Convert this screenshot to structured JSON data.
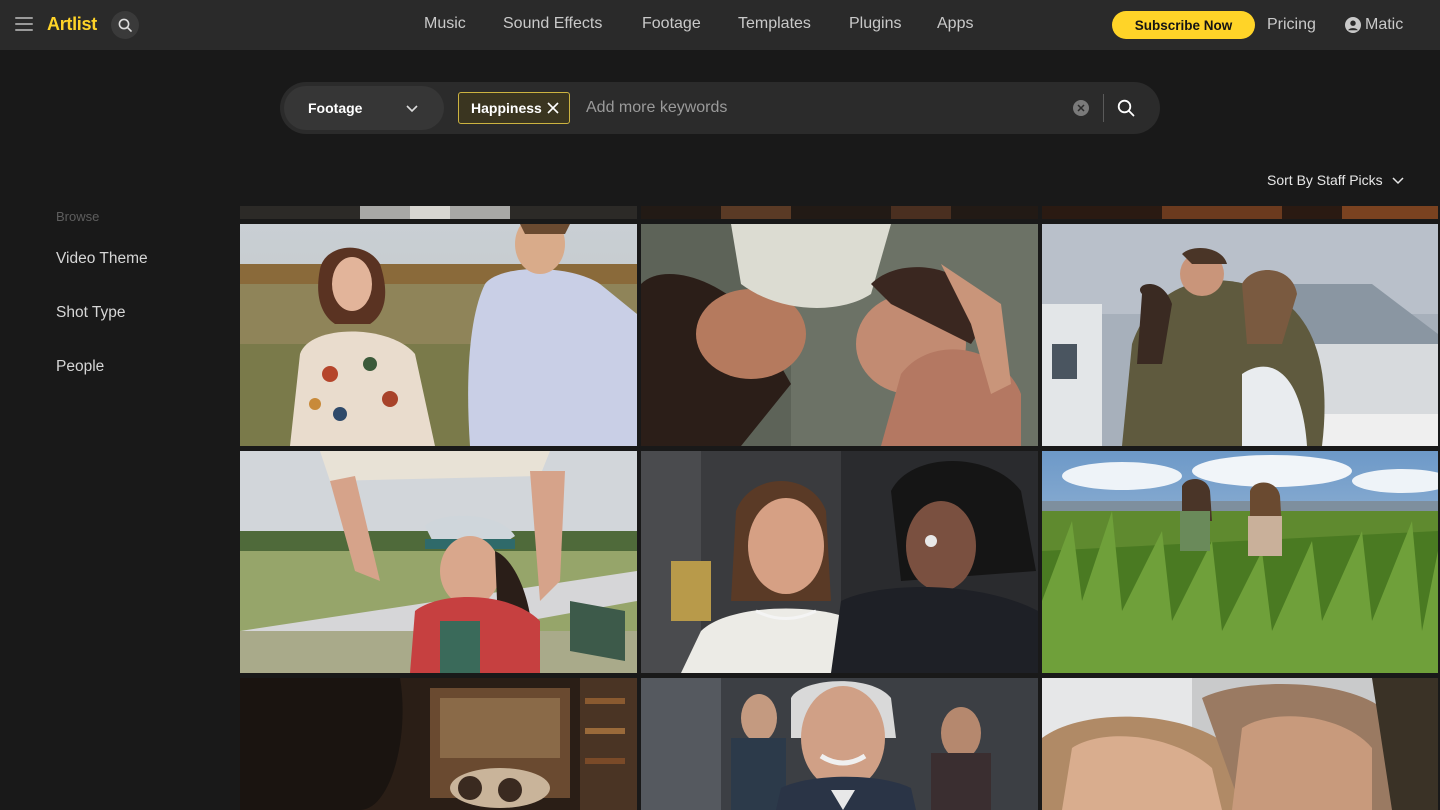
{
  "header": {
    "logo": "Artlist",
    "nav": [
      "Music",
      "Sound Effects",
      "Footage",
      "Templates",
      "Plugins",
      "Apps"
    ],
    "subscribe_label": "Subscribe Now",
    "pricing_label": "Pricing",
    "user_name": "Matic"
  },
  "search": {
    "type_label": "Footage",
    "chip_label": "Happiness",
    "placeholder": "Add more keywords"
  },
  "sort": {
    "label": "Sort By Staff Picks"
  },
  "sidebar": {
    "heading": "Browse",
    "items": [
      "Video Theme",
      "Shot Type",
      "People"
    ]
  },
  "colors": {
    "accent": "#ffd428",
    "background": "#191919",
    "topbar": "#2a2a2a"
  }
}
